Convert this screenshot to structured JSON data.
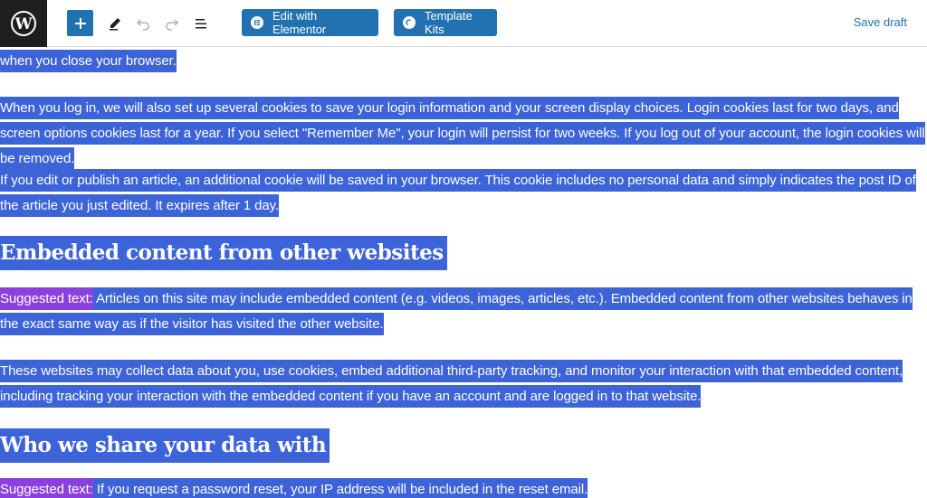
{
  "toolbar": {
    "edit_elementor_label": "Edit with Elementor",
    "template_kits_label": "Template Kits",
    "save_draft_label": "Save draft"
  },
  "content": {
    "p0": "when you close your browser.",
    "p1": "When you log in, we will also set up several cookies to save your login information and your screen display choices. Login cookies last for two days, and screen options cookies last for a year. If you select \"Remember Me\", your login will persist for two weeks. If you log out of your account, the login cookies will be removed.",
    "p2": "If you edit or publish an article, an additional cookie will be saved in your browser. This cookie includes no personal data and simply indicates the post ID of the article you just edited. It expires after 1 day.",
    "h1": "Embedded content from other websites",
    "p3_label": "Suggested text:",
    "p3": " Articles on this site may include embedded content (e.g. videos, images, articles, etc.). Embedded content from other websites behaves in the exact same way as if the visitor has visited the other website.",
    "p4": "These websites may collect data about you, use cookies, embed additional third-party tracking, and monitor your interaction with that embedded content, including tracking your interaction with the embedded content if you have an account and are logged in to that website.",
    "h2": "Who we share your data with",
    "p5_label": "Suggested text:",
    "p5": " If you request a password reset, your IP address will be included in the reset email."
  },
  "colors": {
    "selection": "#3c63d8",
    "suggested": "#8b3fde",
    "accent": "#2271b1",
    "logo_bg": "#1e1e1e"
  },
  "icons": [
    "wordpress-logo-icon",
    "plus-icon",
    "pencil-icon",
    "undo-icon",
    "redo-icon",
    "list-view-icon",
    "elementor-icon",
    "template-kits-icon"
  ]
}
